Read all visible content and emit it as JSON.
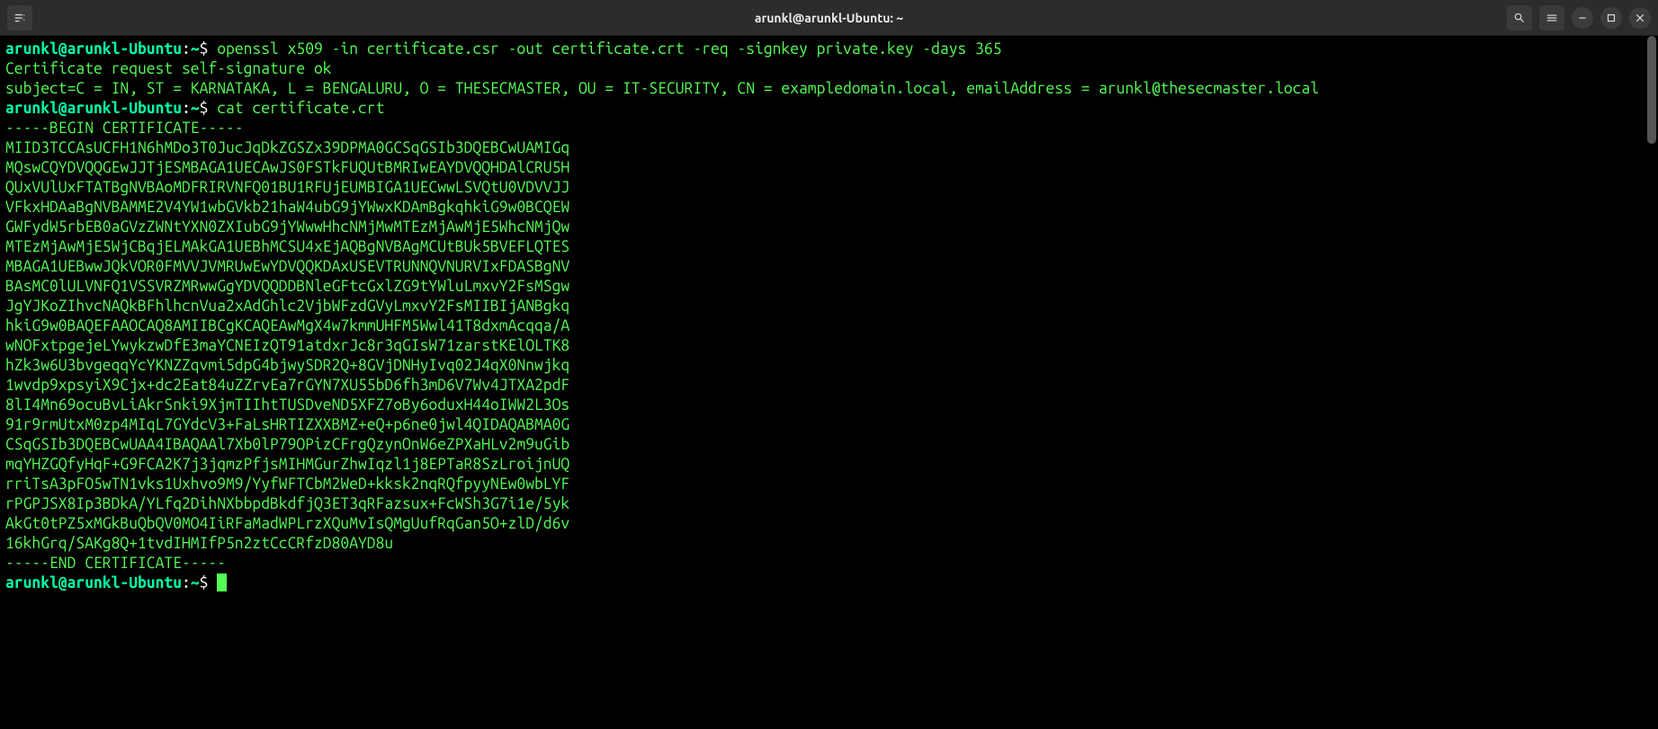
{
  "window": {
    "title": "arunkl@arunkl-Ubuntu: ~"
  },
  "terminal": {
    "prompt": "arunkl@arunkl-Ubuntu",
    "path": "~",
    "symbol": "$",
    "lines": [
      {
        "type": "cmd",
        "text": "openssl x509 -in certificate.csr -out certificate.crt -req -signkey private.key -days 365"
      },
      {
        "type": "out",
        "text": "Certificate request self-signature ok"
      },
      {
        "type": "out",
        "text": "subject=C = IN, ST = KARNATAKA, L = BENGALURU, O = THESECMASTER, OU = IT-SECURITY, CN = exampledomain.local, emailAddress = arunkl@thesecmaster.local"
      },
      {
        "type": "cmd",
        "text": "cat certificate.crt"
      },
      {
        "type": "out",
        "text": "-----BEGIN CERTIFICATE-----"
      },
      {
        "type": "out",
        "text": "MIID3TCCAsUCFH1N6hMDo3T0JucJqDkZGSZx39DPMA0GCSqGSIb3DQEBCwUAMIGq"
      },
      {
        "type": "out",
        "text": "MQswCQYDVQQGEwJJTjESMBAGA1UECAwJS0FSTkFUQUtBMRIwEAYDVQQHDAlCRU5H"
      },
      {
        "type": "out",
        "text": "QUxVUlUxFTATBgNVBAoMDFRIRVNFQ01BU1RFUjEUMBIGA1UECwwLSVQtU0VDVVJJ"
      },
      {
        "type": "out",
        "text": "VFkxHDAaBgNVBAMME2V4YW1wbGVkb21haW4ubG9jYWwxKDAmBgkqhkiG9w0BCQEW"
      },
      {
        "type": "out",
        "text": "GWFydW5rbEB0aGVzZWNtYXN0ZXIubG9jYWwwHhcNMjMwMTEzMjAwMjE5WhcNMjQw"
      },
      {
        "type": "out",
        "text": "MTEzMjAwMjE5WjCBqjELMAkGA1UEBhMCSU4xEjAQBgNVBAgMCUtBUk5BVEFLQTES"
      },
      {
        "type": "out",
        "text": "MBAGA1UEBwwJQkVOR0FMVVJVMRUwEwYDVQQKDAxUSEVTRUNNQVNURVIxFDASBgNV"
      },
      {
        "type": "out",
        "text": "BAsMC0lULVNFQ1VSSVRZMRwwGgYDVQQDDBNleGFtcGxlZG9tYWluLmxvY2FsMSgw"
      },
      {
        "type": "out",
        "text": "JgYJKoZIhvcNAQkBFhlhcnVua2xAdGhlc2VjbWFzdGVyLmxvY2FsMIIBIjANBgkq"
      },
      {
        "type": "out",
        "text": "hkiG9w0BAQEFAAOCAQ8AMIIBCgKCAQEAwMgX4w7kmmUHFM5Wwl41T8dxmAcqqa/A"
      },
      {
        "type": "out",
        "text": "wNOFxtpgejeLYwykzwDfE3maYCNEIzQT91atdxrJc8r3qGIsW71zarstKElOLTK8"
      },
      {
        "type": "out",
        "text": "hZk3w6U3bvgeqqYcYKNZZqvmi5dpG4bjwySDR2Q+8GVjDNHyIvq02J4qX0Nnwjkq"
      },
      {
        "type": "out",
        "text": "1wvdp9xpsyiX9Cjx+dc2Eat84uZZrvEa7rGYN7XU55bD6fh3mD6V7Wv4JTXA2pdF"
      },
      {
        "type": "out",
        "text": "8lI4Mn69ocuBvLiAkrSnki9XjmTIIhtTUSDveND5XFZ7oBy6oduxH44oIWW2L3Os"
      },
      {
        "type": "out",
        "text": "91r9rmUtxM0zp4MIqL7GYdcV3+FaLsHRTIZXXBMZ+eQ+p6ne0jwl4QIDAQABMA0G"
      },
      {
        "type": "out",
        "text": "CSqGSIb3DQEBCwUAA4IBAQAAl7Xb0lP79OPizCFrgQzynOnW6eZPXaHLv2m9uGib"
      },
      {
        "type": "out",
        "text": "mqYHZGQfyHqF+G9FCA2K7j3jqmzPfjsMIHMGurZhwIqzl1j8EPTaR8SzLroijnUQ"
      },
      {
        "type": "out",
        "text": "rriTsA3pFO5wTN1vks1Uxhvo9M9/YyfWFTCbM2WeD+kksk2nqRQfpyyNEw0wbLYF"
      },
      {
        "type": "out",
        "text": "rPGPJSX8Ip3BDkA/YLfq2DihNXbbpdBkdfjQ3ET3qRFazsux+FcWSh3G7i1e/5yk"
      },
      {
        "type": "out",
        "text": "AkGt0tPZ5xMGkBuQbQV0MO4IiRFaMadWPLrzXQuMvIsQMgUufRqGan5O+zlD/d6v"
      },
      {
        "type": "out",
        "text": "16khGrq/SAKg8Q+1tvdIHMIfP5n2ztCcCRfzD80AYD8u"
      },
      {
        "type": "out",
        "text": "-----END CERTIFICATE-----"
      },
      {
        "type": "prompt-empty",
        "text": ""
      }
    ]
  }
}
